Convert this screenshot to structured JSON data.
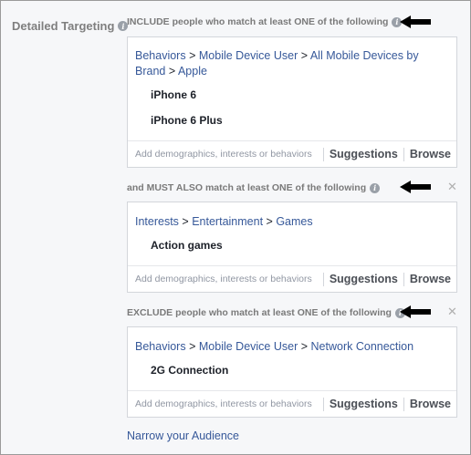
{
  "targeting": {
    "label": "Detailed Targeting",
    "include": {
      "heading": "INCLUDE people who match at least ONE of the following",
      "path": [
        "Behaviors",
        "Mobile Device User",
        "All Mobile Devices by",
        "Brand",
        "Apple"
      ],
      "items": [
        "iPhone 6",
        "iPhone 6 Plus"
      ]
    },
    "must_also": {
      "heading": "and MUST ALSO match at least ONE of the following",
      "path": [
        "Interests",
        "Entertainment",
        "Games"
      ],
      "items": [
        "Action games"
      ]
    },
    "exclude": {
      "heading": "EXCLUDE people who match at least ONE of the following",
      "path": [
        "Behaviors",
        "Mobile Device User",
        "Network Connection"
      ],
      "items": [
        "2G Connection"
      ]
    },
    "placeholder": "Add demographics, interests or behaviors",
    "suggestions_label": "Suggestions",
    "browse_label": "Browse",
    "path_separator": ">",
    "close_glyph": "✕",
    "info_glyph": "i",
    "narrow_link": "Narrow your Audience"
  },
  "colors": {
    "link": "#365899",
    "arrow": "#000000"
  }
}
